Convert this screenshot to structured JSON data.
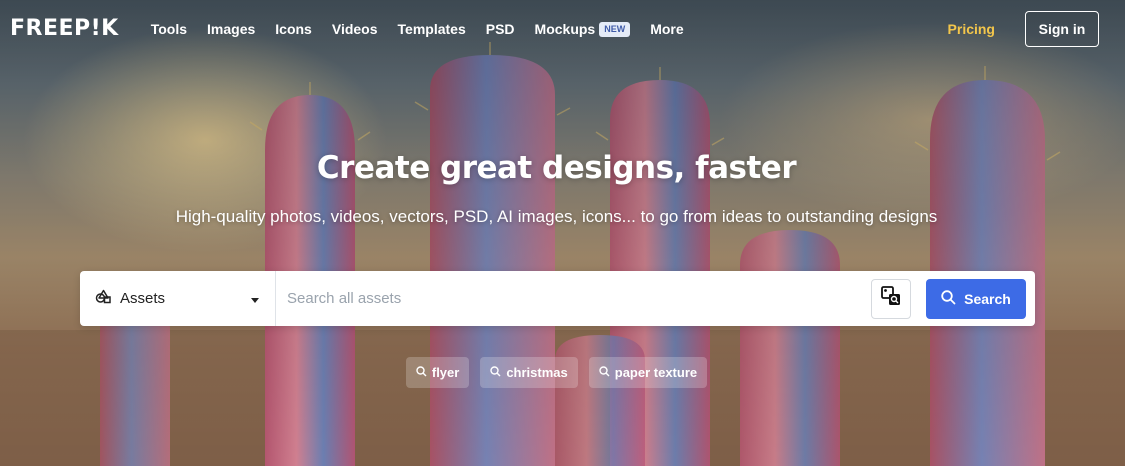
{
  "nav": {
    "logo": "FREEP!K",
    "links": [
      {
        "label": "Tools"
      },
      {
        "label": "Images"
      },
      {
        "label": "Icons"
      },
      {
        "label": "Videos"
      },
      {
        "label": "Templates"
      },
      {
        "label": "PSD"
      },
      {
        "label": "Mockups",
        "badge": "NEW"
      },
      {
        "label": "More"
      }
    ],
    "pricing": "Pricing",
    "signin": "Sign in"
  },
  "hero": {
    "title": "Create great designs, faster",
    "subtitle": "High-quality photos, videos, vectors, PSD, AI images, icons... to go from ideas to outstanding designs"
  },
  "search": {
    "category": "Assets",
    "placeholder": "Search all assets",
    "value": "",
    "button_label": "Search"
  },
  "suggestions": [
    "flyer",
    "christmas",
    "paper texture"
  ],
  "colors": {
    "accent": "#3d6be6",
    "pricing": "#f3c64b",
    "badge_bg": "#e4ebf7"
  },
  "icons": {
    "category": "shapes-icon",
    "caret": "caret-down-icon",
    "image_search": "image-search-icon",
    "search": "search-icon"
  }
}
